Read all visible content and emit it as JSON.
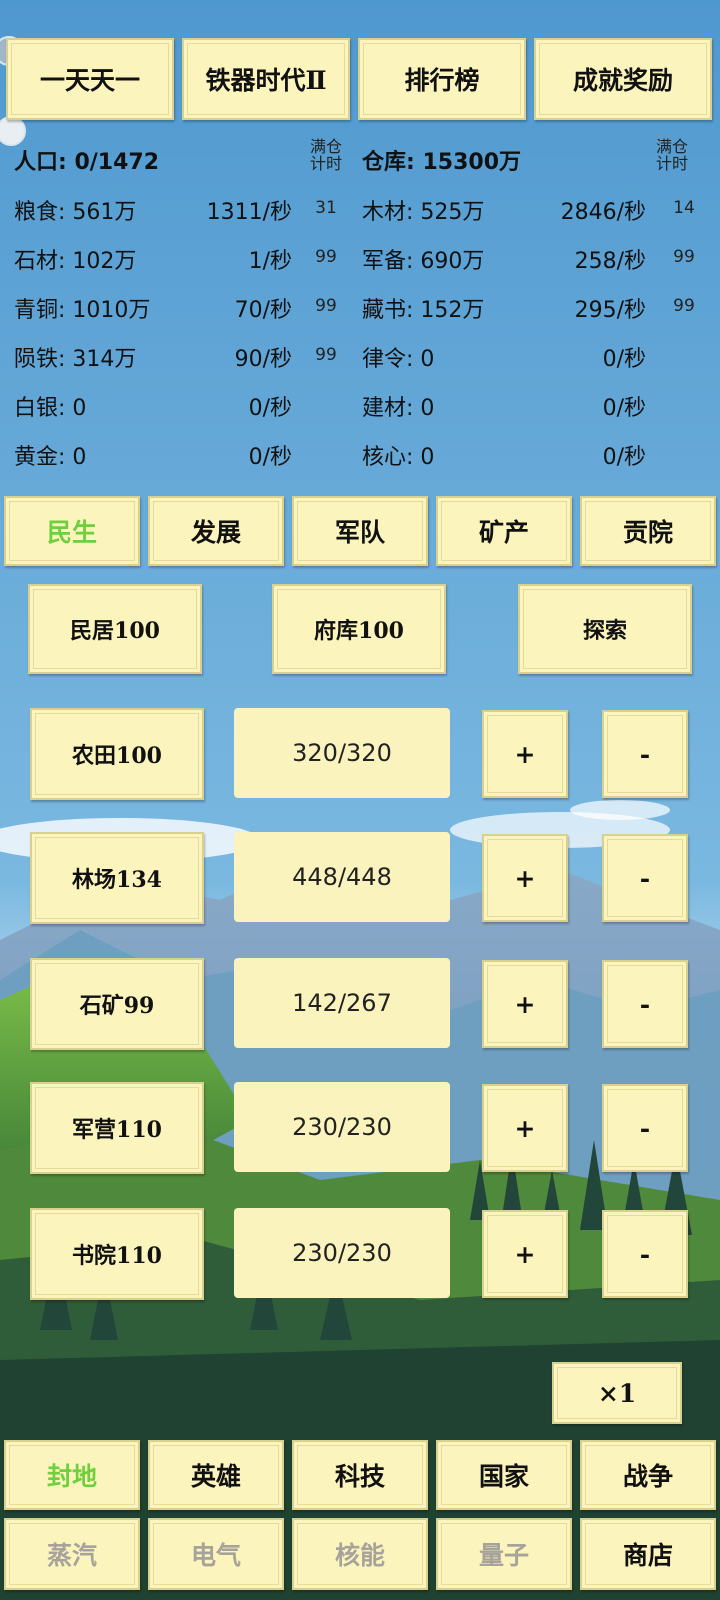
{
  "top_tabs": [
    "一天天一",
    "铁器时代Ⅱ",
    "排行榜",
    "成就奖励"
  ],
  "left_header": {
    "label": "人口: 0/1472",
    "full_label": "满仓计时"
  },
  "right_header": {
    "label": "仓库: 15300万",
    "full_label": "满仓计时"
  },
  "left_resources": [
    {
      "label": "粮食: 561万",
      "rate": "1311/秒",
      "timer": "31"
    },
    {
      "label": "石材: 102万",
      "rate": "1/秒",
      "timer": "99"
    },
    {
      "label": "青铜: 1010万",
      "rate": "70/秒",
      "timer": "99"
    },
    {
      "label": "陨铁: 314万",
      "rate": "90/秒",
      "timer": "99"
    },
    {
      "label": "白银: 0",
      "rate": "0/秒",
      "timer": ""
    },
    {
      "label": "黄金: 0",
      "rate": "0/秒",
      "timer": ""
    }
  ],
  "right_resources": [
    {
      "label": "木材: 525万",
      "rate": "2846/秒",
      "timer": "14"
    },
    {
      "label": "军备: 690万",
      "rate": "258/秒",
      "timer": "99"
    },
    {
      "label": "藏书: 152万",
      "rate": "295/秒",
      "timer": "99"
    },
    {
      "label": "律令: 0",
      "rate": "0/秒",
      "timer": ""
    },
    {
      "label": "建材: 0",
      "rate": "0/秒",
      "timer": ""
    },
    {
      "label": "核心: 0",
      "rate": "0/秒",
      "timer": ""
    }
  ],
  "category_tabs": [
    "民生",
    "发展",
    "军队",
    "矿产",
    "贡院"
  ],
  "top_buildings": [
    "民居100",
    "府库100",
    "探索"
  ],
  "buildings": [
    {
      "name": "农田100",
      "workers": "320/320",
      "plus": "+",
      "minus": "-"
    },
    {
      "name": "林场134",
      "workers": "448/448",
      "plus": "+",
      "minus": "-"
    },
    {
      "name": "石矿99",
      "workers": "142/267",
      "plus": "+",
      "minus": "-"
    },
    {
      "name": "军营110",
      "workers": "230/230",
      "plus": "+",
      "minus": "-"
    },
    {
      "name": "书院110",
      "workers": "230/230",
      "plus": "+",
      "minus": "-"
    }
  ],
  "multiplier": "×1",
  "bottom_row1": [
    "封地",
    "英雄",
    "科技",
    "国家",
    "战争"
  ],
  "bottom_row2": [
    "蒸汽",
    "电气",
    "核能",
    "量子",
    "商店"
  ],
  "colors": {
    "active": "#6fcf3c",
    "disabled": "#a8a39a",
    "button_bg": "#fbf4bd"
  }
}
